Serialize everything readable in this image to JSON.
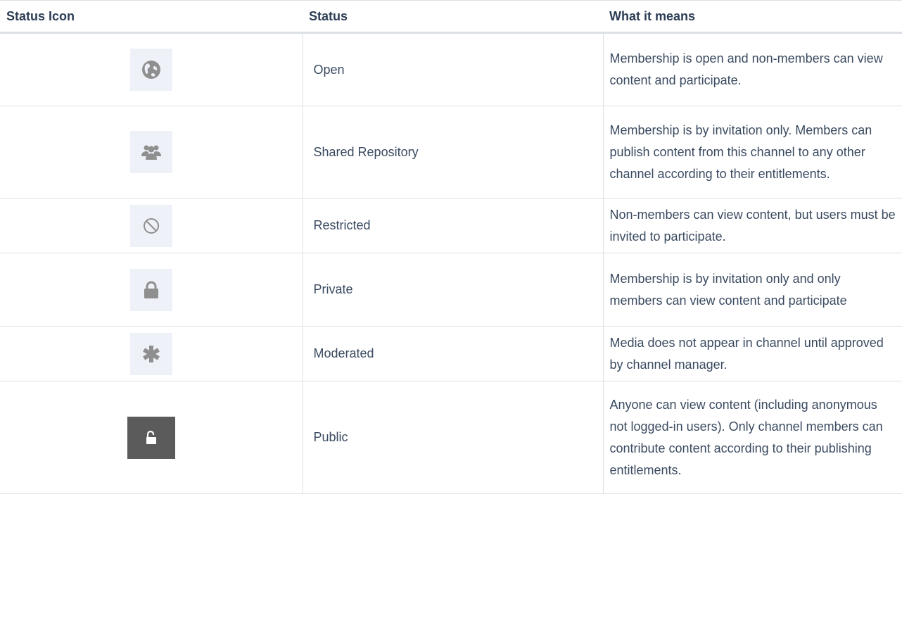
{
  "table": {
    "headers": [
      "Status Icon",
      "Status",
      "What it means"
    ],
    "rows": [
      {
        "icon": "globe-icon",
        "status": "Open",
        "meaning": "Membership is open and non-members can view content and participate."
      },
      {
        "icon": "group-icon",
        "status": "Shared Repository",
        "meaning": "Membership is by invitation only. Members can publish content from this channel to any other channel according to their entitlements."
      },
      {
        "icon": "prohibited-icon",
        "status": "Restricted",
        "meaning": "Non-members can view content, but users must be invited to participate."
      },
      {
        "icon": "lock-icon",
        "status": "Private",
        "meaning": "Membership is by invitation only and only members can view content and participate"
      },
      {
        "icon": "asterisk-icon",
        "status": "Moderated",
        "meaning": "Media does not appear in channel until approved by channel manager."
      },
      {
        "icon": "unlock-icon",
        "status": "Public",
        "meaning": "Anyone can view content (including anonymous not logged-in users). Only channel members can contribute content according to their publishing entitlements."
      }
    ]
  },
  "colors": {
    "text": "#3a4a60",
    "border": "#dde0e5",
    "icon_bg": "#eef2f8",
    "icon_gray": "#8f8f8f",
    "public_bg": "#5b5b5b"
  }
}
